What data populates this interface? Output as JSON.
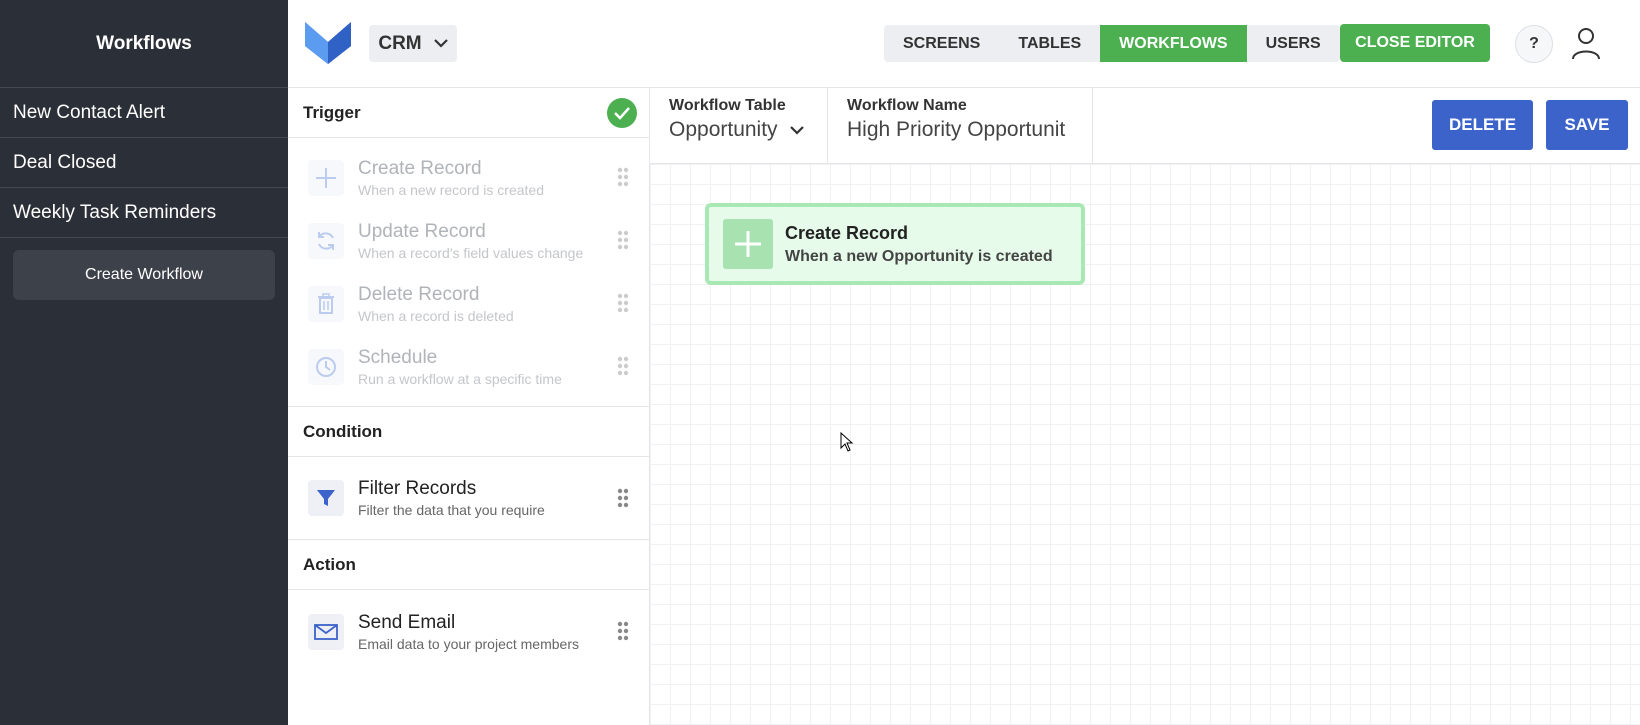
{
  "sidebar": {
    "title": "Workflows",
    "items": [
      {
        "label": "New Contact Alert"
      },
      {
        "label": "Deal Closed"
      },
      {
        "label": "Weekly Task Reminders"
      }
    ],
    "create_label": "Create Workflow"
  },
  "topbar": {
    "app_label": "CRM",
    "tabs": [
      {
        "label": "SCREENS"
      },
      {
        "label": "TABLES"
      },
      {
        "label": "WORKFLOWS",
        "active": true
      },
      {
        "label": "USERS"
      }
    ],
    "close_editor_label": "CLOSE EDITOR",
    "help_label": "?"
  },
  "panel": {
    "trigger": {
      "title": "Trigger",
      "nodes": [
        {
          "title": "Create Record",
          "subtitle": "When a new record is created",
          "icon": "plus-icon"
        },
        {
          "title": "Update Record",
          "subtitle": "When a record's field values change",
          "icon": "refresh-icon"
        },
        {
          "title": "Delete Record",
          "subtitle": "When a record is deleted",
          "icon": "trash-icon"
        },
        {
          "title": "Schedule",
          "subtitle": "Run a workflow at a specific time",
          "icon": "clock-icon"
        }
      ]
    },
    "condition": {
      "title": "Condition",
      "nodes": [
        {
          "title": "Filter Records",
          "subtitle": "Filter the data that you require",
          "icon": "funnel-icon"
        }
      ]
    },
    "action": {
      "title": "Action",
      "nodes": [
        {
          "title": "Send Email",
          "subtitle": "Email data to your project members",
          "icon": "mail-icon"
        }
      ]
    }
  },
  "editor": {
    "table_label": "Workflow Table",
    "table_value": "Opportunity",
    "name_label": "Workflow Name",
    "name_value": "High Priority Opportunit",
    "delete_label": "DELETE",
    "save_label": "SAVE"
  },
  "canvas": {
    "card": {
      "title": "Create Record",
      "subtitle": "When a new Opportunity is created",
      "icon": "plus-icon"
    }
  },
  "colors": {
    "accent_green": "#4caf50",
    "accent_blue": "#3b63c9",
    "sidebar_bg": "#2b2f37"
  }
}
